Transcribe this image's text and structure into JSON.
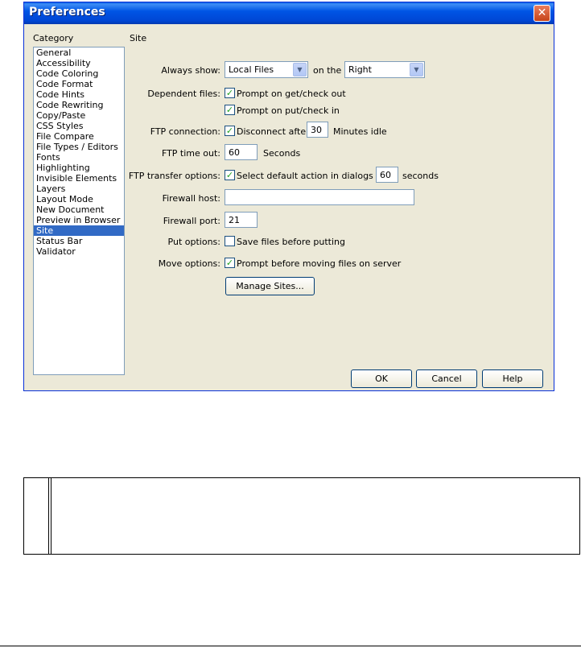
{
  "window": {
    "title": "Preferences",
    "close_glyph": "✕"
  },
  "category": {
    "header": "Category",
    "items": [
      "General",
      "Accessibility",
      "Code Coloring",
      "Code Format",
      "Code Hints",
      "Code Rewriting",
      "Copy/Paste",
      "CSS Styles",
      "File Compare",
      "File Types / Editors",
      "Fonts",
      "Highlighting",
      "Invisible Elements",
      "Layers",
      "Layout Mode",
      "New Document",
      "Preview in Browser",
      "Site",
      "Status Bar",
      "Validator"
    ],
    "selected_index": 17
  },
  "site": {
    "header": "Site",
    "always_show_label": "Always show:",
    "always_show_value": "Local Files",
    "on_the_label": "on the",
    "side_value": "Right",
    "dependent_files_label": "Dependent files:",
    "prompt_get_checkout": "Prompt on get/check out",
    "prompt_put_checkin": "Prompt on put/check in",
    "ftp_connection_label": "FTP connection:",
    "disconnect_after": "Disconnect after",
    "disconnect_minutes": "30",
    "minutes_idle": "Minutes idle",
    "ftp_timeout_label": "FTP time out:",
    "ftp_timeout_value": "60",
    "seconds": "Seconds",
    "ftp_transfer_label": "FTP transfer options:",
    "select_default_action": "Select default action in dialogs after",
    "default_action_seconds": "60",
    "seconds_lower": "seconds",
    "firewall_host_label": "Firewall host:",
    "firewall_host_value": "",
    "firewall_port_label": "Firewall port:",
    "firewall_port_value": "21",
    "put_options_label": "Put options:",
    "save_before_putting": "Save files before putting",
    "move_options_label": "Move options:",
    "prompt_before_moving": "Prompt before moving files on server",
    "manage_sites": "Manage Sites..."
  },
  "buttons": {
    "ok": "OK",
    "cancel": "Cancel",
    "help": "Help"
  },
  "checkbox_glyph": "✓",
  "arrow_glyph": "▼"
}
